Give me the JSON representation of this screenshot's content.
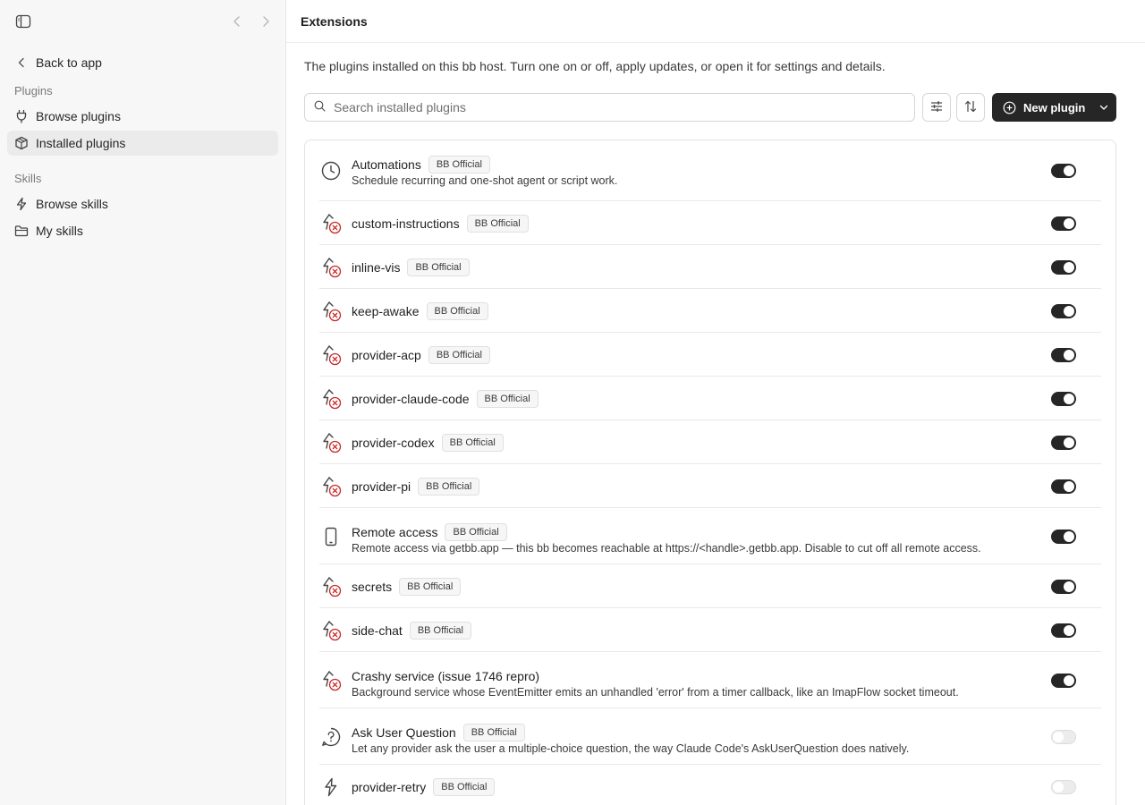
{
  "sidebar": {
    "back_label": "Back to app",
    "plugins_section": "Plugins",
    "browse_plugins": "Browse plugins",
    "installed_plugins": "Installed plugins",
    "skills_section": "Skills",
    "browse_skills": "Browse skills",
    "my_skills": "My skills"
  },
  "header": {
    "title": "Extensions"
  },
  "main": {
    "description": "The plugins installed on this bb host. Turn one on or off, apply updates, or open it for settings and details.",
    "search_placeholder": "Search installed plugins",
    "new_plugin_label": "New plugin"
  },
  "plugins": [
    {
      "name": "Automations",
      "badge": "BB Official",
      "description": "Schedule recurring and one-shot agent or script work.",
      "icon": "clock-icon",
      "enabled": true
    },
    {
      "name": "custom-instructions",
      "badge": "BB Official",
      "description": "",
      "icon": "plugin-error-icon",
      "enabled": true
    },
    {
      "name": "inline-vis",
      "badge": "BB Official",
      "description": "",
      "icon": "plugin-error-icon",
      "enabled": true
    },
    {
      "name": "keep-awake",
      "badge": "BB Official",
      "description": "",
      "icon": "plugin-error-icon",
      "enabled": true
    },
    {
      "name": "provider-acp",
      "badge": "BB Official",
      "description": "",
      "icon": "plugin-error-icon",
      "enabled": true
    },
    {
      "name": "provider-claude-code",
      "badge": "BB Official",
      "description": "",
      "icon": "plugin-error-icon",
      "enabled": true
    },
    {
      "name": "provider-codex",
      "badge": "BB Official",
      "description": "",
      "icon": "plugin-error-icon",
      "enabled": true
    },
    {
      "name": "provider-pi",
      "badge": "BB Official",
      "description": "",
      "icon": "plugin-error-icon",
      "enabled": true
    },
    {
      "name": "Remote access",
      "badge": "BB Official",
      "description": "Remote access via getbb.app — this bb becomes reachable at https://<handle>.getbb.app. Disable to cut off all remote access.",
      "icon": "phone-icon",
      "enabled": true
    },
    {
      "name": "secrets",
      "badge": "BB Official",
      "description": "",
      "icon": "plugin-error-icon",
      "enabled": true
    },
    {
      "name": "side-chat",
      "badge": "BB Official",
      "description": "",
      "icon": "plugin-error-icon",
      "enabled": true
    },
    {
      "name": "Crashy service (issue 1746 repro)",
      "badge": "",
      "description": "Background service whose EventEmitter emits an unhandled 'error' from a timer callback, like an ImapFlow socket timeout.",
      "icon": "plugin-error-icon",
      "enabled": true
    },
    {
      "name": "Ask User Question",
      "badge": "BB Official",
      "description": "Let any provider ask the user a multiple-choice question, the way Claude Code's AskUserQuestion does natively.",
      "icon": "question-icon",
      "enabled": false
    },
    {
      "name": "provider-retry",
      "badge": "BB Official",
      "description": "",
      "icon": "plug-icon",
      "enabled": false
    }
  ],
  "colors": {
    "accent": "#262626",
    "error": "#c62828",
    "sidebar_bg": "#f7f7f7"
  }
}
